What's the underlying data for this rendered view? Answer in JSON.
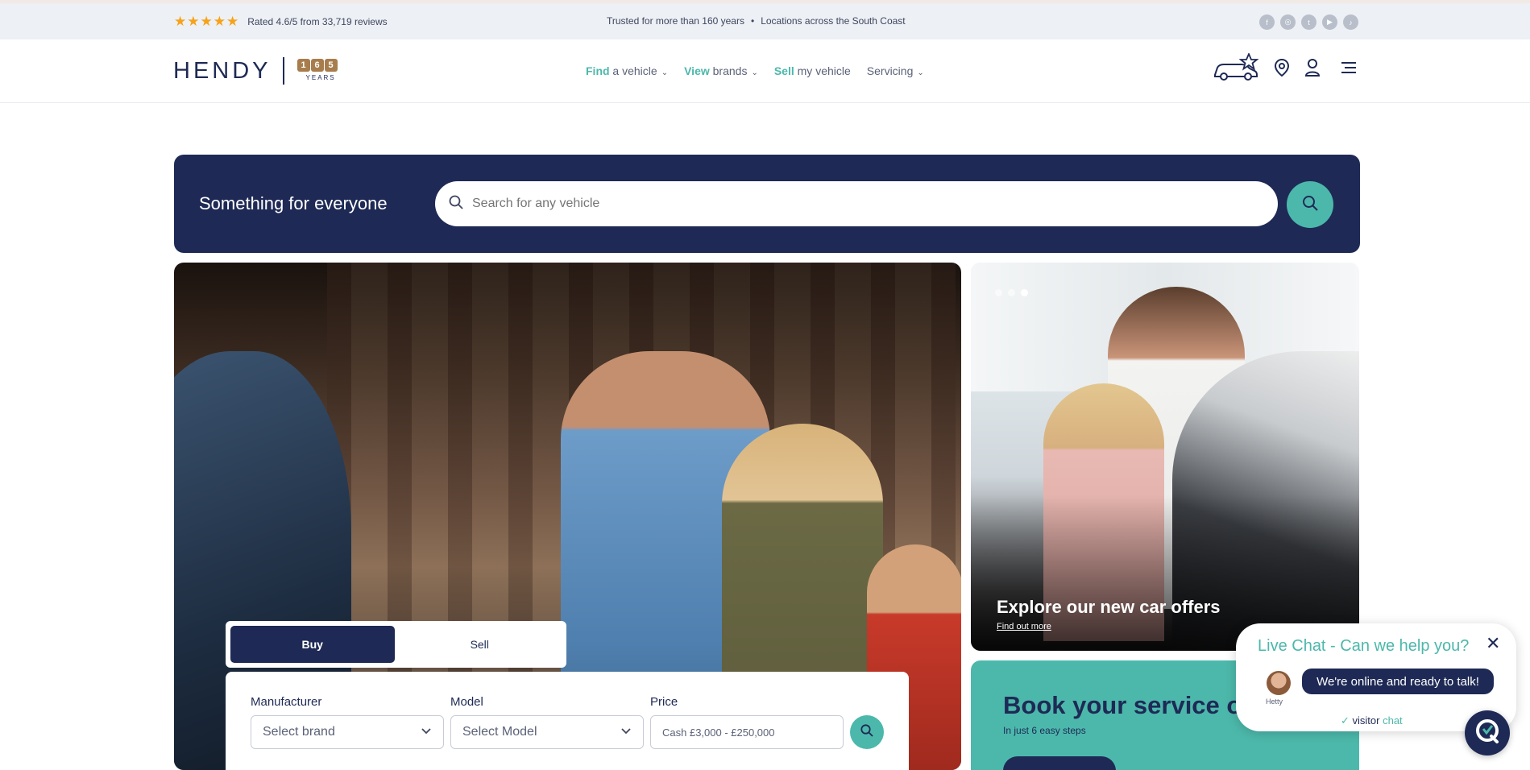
{
  "topbar": {
    "stars": "★★★★★",
    "rating_text": "Rated 4.6/5 from 33,719 reviews",
    "trusted_text": "Trusted for more than 160 years",
    "bullet": "•",
    "locations_text": "Locations across the South Coast",
    "social_icons": [
      "facebook-icon",
      "instagram-icon",
      "twitter-icon",
      "youtube-icon",
      "tiktok-icon"
    ]
  },
  "header": {
    "logo_word": "HENDY",
    "logo_digits": [
      "1",
      "6",
      "5"
    ],
    "logo_years": "YEARS",
    "nav": [
      {
        "bold": "Find",
        "rest": " a vehicle",
        "has_menu": true
      },
      {
        "bold": "View",
        "rest": " brands",
        "has_menu": true
      },
      {
        "bold": "Sell",
        "rest": " my vehicle",
        "has_menu": false
      },
      {
        "bold": "",
        "rest": "Servicing",
        "has_menu": true
      }
    ]
  },
  "search_band": {
    "title": "Something for everyone",
    "placeholder": "Search for any vehicle"
  },
  "finder": {
    "tabs": [
      "Buy",
      "Sell"
    ],
    "active_tab": "Buy",
    "manufacturer_label": "Manufacturer",
    "manufacturer_value": "Select brand",
    "model_label": "Model",
    "model_value": "Select Model",
    "price_label": "Price",
    "price_value": "Cash £3,000 - £250,000"
  },
  "offer_card": {
    "title": "Explore our new car offers",
    "link": "Find out more"
  },
  "service_card": {
    "title": "Book your service on",
    "subtitle": "In just 6 easy steps"
  },
  "chat": {
    "title": "Live Chat - Can we help you?",
    "bubble": "We're online and ready to talk!",
    "agent_name": "Hetty",
    "brand_prefix": "visitor",
    "brand_suffix": " chat"
  },
  "colors": {
    "navy": "#1e2a55",
    "teal": "#4cb8ab",
    "star": "#f6a21a",
    "gold": "#a87d4d"
  }
}
